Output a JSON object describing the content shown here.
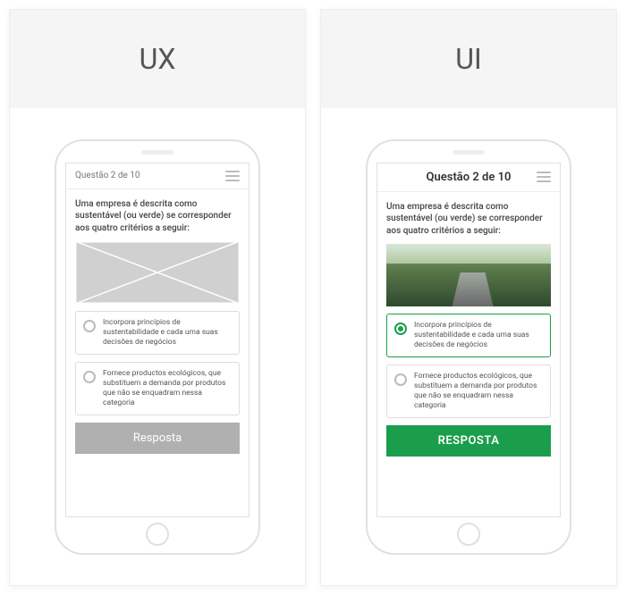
{
  "panels": {
    "ux": {
      "title": "UX"
    },
    "ui": {
      "title": "UI"
    }
  },
  "quiz": {
    "progress_ux": "Questão 2 de 10",
    "progress_ui": "Questão 2 de 10",
    "question": "Uma empresa é descrita como sustentável (ou verde) se corresponder aos quatro critérios a seguir:",
    "options": [
      {
        "text": "Incorpora princípios de sustentabilidade e cada uma suas decisões de negócios"
      },
      {
        "text": "Fornece productos ecológicos, que substituem a demanda por produtos que não se enquadram nessa categoria"
      }
    ],
    "button_ux": "Resposta",
    "button_ui": "RESPOSTA"
  },
  "icons": {
    "menu": "menu-icon",
    "image_placeholder": "image-placeholder-icon"
  },
  "colors": {
    "accent": "#1a9e4b",
    "muted": "#b0b0b0"
  }
}
